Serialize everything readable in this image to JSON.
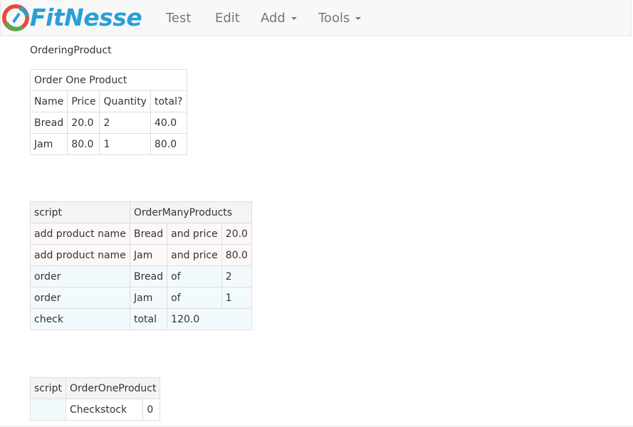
{
  "brand": {
    "name": "FitNesse",
    "logo_icon": "fitnesse-logo-icon"
  },
  "nav": {
    "test_label": "Test",
    "edit_label": "Edit",
    "add_label": "Add",
    "tools_label": "Tools"
  },
  "page": {
    "name": "OrderingProduct"
  },
  "table1": {
    "title": "Order One Product",
    "headers": [
      "Name",
      "Price",
      "Quantity",
      "total?"
    ],
    "rows": [
      [
        "Bread",
        "20.0",
        "2",
        "40.0"
      ],
      [
        "Jam",
        "80.0",
        "1",
        "80.0"
      ]
    ]
  },
  "table2": {
    "header": [
      "script",
      "OrderManyProducts"
    ],
    "rows": [
      [
        "add product name",
        "Bread",
        "and price",
        "20.0"
      ],
      [
        "add product name",
        "Jam",
        "and price",
        "80.0"
      ],
      [
        "order",
        "Bread",
        "of",
        "2"
      ],
      [
        "order",
        "Jam",
        "of",
        "1"
      ],
      [
        "check",
        "total",
        "120.0"
      ]
    ]
  },
  "table3": {
    "header": [
      "script",
      "OrderOneProduct"
    ],
    "row": [
      "",
      "Checkstock",
      "0"
    ]
  },
  "colors": {
    "brand_blue": "#2a9fd6",
    "logo_red": "#e74c3c",
    "logo_green": "#4caf50",
    "navbar_bg": "#f8f8f8",
    "header_cell_bg": "#f4f4f4",
    "action_row_bg": "#fdf7f7",
    "check_row_bg": "#f3fafe"
  }
}
